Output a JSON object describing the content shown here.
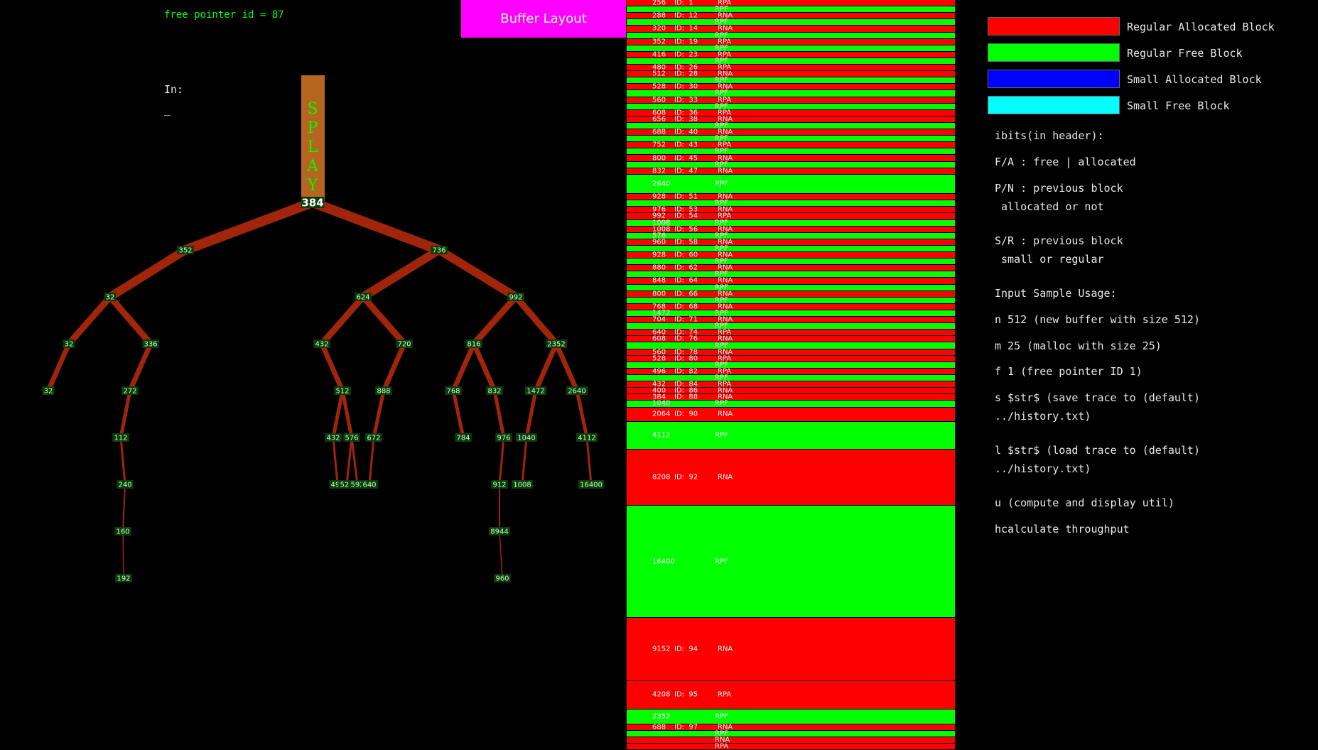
{
  "status": {
    "free_pointer": "free pointer id = 87"
  },
  "input": {
    "label": "In:",
    "cursor": "_"
  },
  "header": {
    "title": "Buffer Layout"
  },
  "splay": {
    "label": "SPLAY",
    "letters": [
      "S",
      "P",
      "L",
      "A",
      "Y"
    ],
    "root": "384"
  },
  "tree": {
    "nodes": [
      {
        "id": "n384",
        "label": "384",
        "parent": null
      },
      {
        "id": "n352",
        "label": "352",
        "parent": "n384"
      },
      {
        "id": "n736",
        "label": "736",
        "parent": "n384"
      },
      {
        "id": "n32a",
        "label": "32",
        "parent": "n352"
      },
      {
        "id": "n624",
        "label": "624",
        "parent": "n736"
      },
      {
        "id": "n992",
        "label": "992",
        "parent": "n736"
      },
      {
        "id": "n32b",
        "label": "32",
        "parent": "n32a"
      },
      {
        "id": "n336",
        "label": "336",
        "parent": "n32a"
      },
      {
        "id": "n432a",
        "label": "432",
        "parent": "n624"
      },
      {
        "id": "n720",
        "label": "720",
        "parent": "n624"
      },
      {
        "id": "n816",
        "label": "816",
        "parent": "n992"
      },
      {
        "id": "n2352",
        "label": "2352",
        "parent": "n992"
      },
      {
        "id": "n32c",
        "label": "32",
        "parent": "n32b"
      },
      {
        "id": "n272",
        "label": "272",
        "parent": "n336"
      },
      {
        "id": "n512",
        "label": "512",
        "parent": "n432a"
      },
      {
        "id": "n888",
        "label": "888",
        "parent": "n720"
      },
      {
        "id": "n768",
        "label": "768",
        "parent": "n816"
      },
      {
        "id": "n832",
        "label": "832",
        "parent": "n816"
      },
      {
        "id": "n1472",
        "label": "1472",
        "parent": "n2352"
      },
      {
        "id": "n2640",
        "label": "2640",
        "parent": "n2352"
      },
      {
        "id": "n112",
        "label": "112",
        "parent": "n272"
      },
      {
        "id": "n432b",
        "label": "432",
        "parent": "n512"
      },
      {
        "id": "n576",
        "label": "576",
        "parent": "n512"
      },
      {
        "id": "n672",
        "label": "672",
        "parent": "n888"
      },
      {
        "id": "n784",
        "label": "784",
        "parent": "n768"
      },
      {
        "id": "n976",
        "label": "976",
        "parent": "n832"
      },
      {
        "id": "n1040",
        "label": "1040",
        "parent": "n1472"
      },
      {
        "id": "n4112",
        "label": "4112",
        "parent": "n2640"
      },
      {
        "id": "n240",
        "label": "240",
        "parent": "n112"
      },
      {
        "id": "n496",
        "label": "496",
        "parent": "n432b"
      },
      {
        "id": "n528",
        "label": "528",
        "parent": "n576"
      },
      {
        "id": "n592",
        "label": "592",
        "parent": "n576"
      },
      {
        "id": "n640",
        "label": "640",
        "parent": "n672"
      },
      {
        "id": "n912",
        "label": "912",
        "parent": "n976"
      },
      {
        "id": "n1008",
        "label": "1008",
        "parent": "n1040"
      },
      {
        "id": "n16400",
        "label": "16400",
        "parent": "n4112"
      },
      {
        "id": "n160",
        "label": "160",
        "parent": "n240"
      },
      {
        "id": "n8944",
        "label": "8944",
        "parent": "n912"
      },
      {
        "id": "n192",
        "label": "192",
        "parent": "n160"
      },
      {
        "id": "n960",
        "label": "960",
        "parent": "n8944"
      }
    ]
  },
  "buffer": {
    "colors": {
      "RNA": "#ff0000",
      "RPA": "#ff0000",
      "RPF": "#00ff00",
      "RNF": "#00ff00"
    },
    "blocks": [
      {
        "size": "256",
        "id": "1",
        "flag": "RPA",
        "weight": 1
      },
      {
        "size": "",
        "id": "",
        "flag": "RPF",
        "weight": 1
      },
      {
        "size": "288",
        "id": "12",
        "flag": "RNA",
        "weight": 1
      },
      {
        "size": "",
        "id": "",
        "flag": "RPF",
        "weight": 1
      },
      {
        "size": "320",
        "id": "14",
        "flag": "RNA",
        "weight": 1
      },
      {
        "size": "",
        "id": "",
        "flag": "RPF",
        "weight": 1
      },
      {
        "size": "352",
        "id": "19",
        "flag": "RPA",
        "weight": 1
      },
      {
        "size": "",
        "id": "",
        "flag": "RPF",
        "weight": 1
      },
      {
        "size": "416",
        "id": "23",
        "flag": "RPA",
        "weight": 1
      },
      {
        "size": "",
        "id": "",
        "flag": "RPF",
        "weight": 1
      },
      {
        "size": "480",
        "id": "26",
        "flag": "RPA",
        "weight": 1
      },
      {
        "size": "512",
        "id": "28",
        "flag": "RNA",
        "weight": 1
      },
      {
        "size": "",
        "id": "",
        "flag": "RPF",
        "weight": 1
      },
      {
        "size": "528",
        "id": "30",
        "flag": "RNA",
        "weight": 1
      },
      {
        "size": "",
        "id": "",
        "flag": "RPF",
        "weight": 1
      },
      {
        "size": "560",
        "id": "33",
        "flag": "RPA",
        "weight": 1
      },
      {
        "size": "",
        "id": "",
        "flag": "RPF",
        "weight": 1
      },
      {
        "size": "608",
        "id": "36",
        "flag": "RPA",
        "weight": 1
      },
      {
        "size": "656",
        "id": "38",
        "flag": "RNA",
        "weight": 1
      },
      {
        "size": "",
        "id": "",
        "flag": "RPF",
        "weight": 1
      },
      {
        "size": "688",
        "id": "40",
        "flag": "RNA",
        "weight": 1
      },
      {
        "size": "",
        "id": "",
        "flag": "RPF",
        "weight": 1
      },
      {
        "size": "752",
        "id": "43",
        "flag": "RPA",
        "weight": 1
      },
      {
        "size": "",
        "id": "",
        "flag": "RPF",
        "weight": 1
      },
      {
        "size": "800",
        "id": "45",
        "flag": "RNA",
        "weight": 1
      },
      {
        "size": "",
        "id": "",
        "flag": "RPF",
        "weight": 1
      },
      {
        "size": "832",
        "id": "47",
        "flag": "RNA",
        "weight": 1
      },
      {
        "size": "2640",
        "id": "",
        "flag": "RPF",
        "weight": 3
      },
      {
        "size": "928",
        "id": "51",
        "flag": "RNA",
        "weight": 1
      },
      {
        "size": "",
        "id": "",
        "flag": "RPF",
        "weight": 1
      },
      {
        "size": "976",
        "id": "53",
        "flag": "RNA",
        "weight": 1
      },
      {
        "size": "992",
        "id": "54",
        "flag": "RPA",
        "weight": 1
      },
      {
        "size": "1008",
        "id": "",
        "flag": "RPF",
        "weight": 1
      },
      {
        "size": "1008",
        "id": "56",
        "flag": "RNA",
        "weight": 1
      },
      {
        "size": "576",
        "id": "",
        "flag": "RPF",
        "weight": 1
      },
      {
        "size": "960",
        "id": "58",
        "flag": "RNA",
        "weight": 1
      },
      {
        "size": "",
        "id": "",
        "flag": "RPF",
        "weight": 1
      },
      {
        "size": "928",
        "id": "60",
        "flag": "RNA",
        "weight": 1
      },
      {
        "size": "",
        "id": "",
        "flag": "RPF",
        "weight": 1
      },
      {
        "size": "880",
        "id": "62",
        "flag": "RNA",
        "weight": 1
      },
      {
        "size": "",
        "id": "",
        "flag": "RPF",
        "weight": 1
      },
      {
        "size": "848",
        "id": "64",
        "flag": "RNA",
        "weight": 1
      },
      {
        "size": "",
        "id": "",
        "flag": "RPF",
        "weight": 1
      },
      {
        "size": "800",
        "id": "66",
        "flag": "RNA",
        "weight": 1
      },
      {
        "size": "",
        "id": "",
        "flag": "RPF",
        "weight": 1
      },
      {
        "size": "768",
        "id": "68",
        "flag": "RNA",
        "weight": 1
      },
      {
        "size": "1472",
        "id": "",
        "flag": "RPF",
        "weight": 1
      },
      {
        "size": "704",
        "id": "71",
        "flag": "RNA",
        "weight": 1
      },
      {
        "size": "",
        "id": "",
        "flag": "RPF",
        "weight": 1
      },
      {
        "size": "640",
        "id": "74",
        "flag": "RPA",
        "weight": 1
      },
      {
        "size": "608",
        "id": "76",
        "flag": "RNA",
        "weight": 1
      },
      {
        "size": "",
        "id": "",
        "flag": "RPF",
        "weight": 1
      },
      {
        "size": "560",
        "id": "78",
        "flag": "RNA",
        "weight": 1
      },
      {
        "size": "528",
        "id": "80",
        "flag": "RPA",
        "weight": 1
      },
      {
        "size": "",
        "id": "",
        "flag": "RPF",
        "weight": 1
      },
      {
        "size": "496",
        "id": "82",
        "flag": "RPA",
        "weight": 1
      },
      {
        "size": "",
        "id": "",
        "flag": "RPF",
        "weight": 1
      },
      {
        "size": "432",
        "id": "84",
        "flag": "RPA",
        "weight": 1
      },
      {
        "size": "400",
        "id": "86",
        "flag": "RNA",
        "weight": 1
      },
      {
        "size": "384",
        "id": "88",
        "flag": "RNA",
        "weight": 1
      },
      {
        "size": "1040",
        "id": "",
        "flag": "RPF",
        "weight": 1
      },
      {
        "size": "2064",
        "id": "90",
        "flag": "RNA",
        "weight": 2.2
      },
      {
        "size": "4112",
        "id": "",
        "flag": "RPF",
        "weight": 4.3
      },
      {
        "size": "8208",
        "id": "92",
        "flag": "RNA",
        "weight": 8.7
      },
      {
        "size": "16400",
        "id": "",
        "flag": "RPF",
        "weight": 17.4
      },
      {
        "size": "9152",
        "id": "94",
        "flag": "RNA",
        "weight": 9.7
      },
      {
        "size": "4208",
        "id": "95",
        "flag": "RPA",
        "weight": 4.4
      },
      {
        "size": "2352",
        "id": "",
        "flag": "RPF",
        "weight": 2.3
      },
      {
        "size": "688",
        "id": "97",
        "flag": "RNA",
        "weight": 1
      },
      {
        "size": "",
        "id": "",
        "flag": "RPF",
        "weight": 1
      },
      {
        "size": "",
        "id": "",
        "flag": "RNA",
        "weight": 1
      },
      {
        "size": "",
        "id": "",
        "flag": "RPA",
        "weight": 1
      }
    ]
  },
  "legend": {
    "items": [
      {
        "label": "Regular Allocated Block",
        "color": "#ff0000"
      },
      {
        "label": "Regular Free Block",
        "color": "#00ff00"
      },
      {
        "label": "Small Allocated Block",
        "color": "#0000ff"
      },
      {
        "label": "Small Free Block",
        "color": "#00ffff"
      }
    ]
  },
  "help": {
    "ibits": "ibits(in header):",
    "fa": "F/A : free | allocated",
    "pn": "P/N : previous block\n allocated or not",
    "sr": "S/R : previous block\n small or regular",
    "usage": "Input Sample Usage:",
    "n": "n 512 (new buffer with size 512)",
    "m": "m 25 (malloc with size 25)",
    "f": "f 1 (free pointer ID 1)",
    "s": "s $str$ (save trace to (default)\n../history.txt)",
    "l": "l $str$ (load trace to (default)\n../history.txt)",
    "u": "u (compute and display util)",
    "h": "hcalculate throughput"
  }
}
